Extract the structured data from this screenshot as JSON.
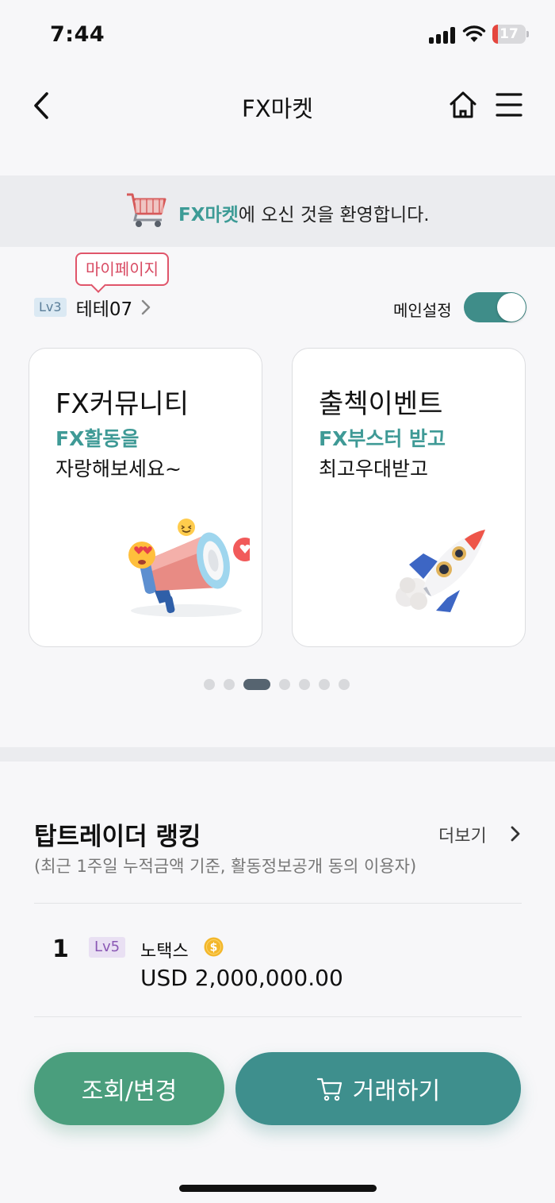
{
  "status_bar": {
    "time": "7:44",
    "battery": "17",
    "battery_level_percent": 17
  },
  "nav": {
    "title": "FX마켓",
    "back_icon": "chevron-left-icon",
    "home_icon": "home-icon",
    "menu_icon": "hamburger-menu-icon"
  },
  "welcome": {
    "highlight": "FX마켓",
    "text": "에 오신 것을 환영합니다."
  },
  "profile": {
    "mypage_label": "마이페이지",
    "level": "Lv3",
    "nickname": "테테07",
    "main_setting_label": "메인설정",
    "main_setting_on": true
  },
  "cards": [
    {
      "title": "FX커뮤니티",
      "highlight": "FX활동을",
      "subtitle": "자랑해보세요~",
      "icon": "megaphone-icon"
    },
    {
      "title": "출첵이벤트",
      "highlight": "FX부스터 받고",
      "subtitle": "최고우대받고",
      "icon": "rocket-icon"
    }
  ],
  "carousel": {
    "total": 7,
    "active_index": 2
  },
  "ranking": {
    "title": "탑트레이더 랭킹",
    "more_label": "더보기",
    "subtitle": "(최근 1주일 누적금액 기준, 활동정보공개 동의 이용자)",
    "rows": [
      {
        "rank": "1",
        "level": "Lv5",
        "name": "노택스",
        "amount": "USD 2,000,000.00",
        "icon": "dollar-coin-icon"
      }
    ]
  },
  "buttons": {
    "inquiry": "조회/변경",
    "trade": "거래하기"
  },
  "colors": {
    "accent_teal": "#3d9b96",
    "inquiry_green": "#4a9e7d",
    "trade_teal": "#3e8f8d",
    "mypage_red": "#e0556a"
  }
}
